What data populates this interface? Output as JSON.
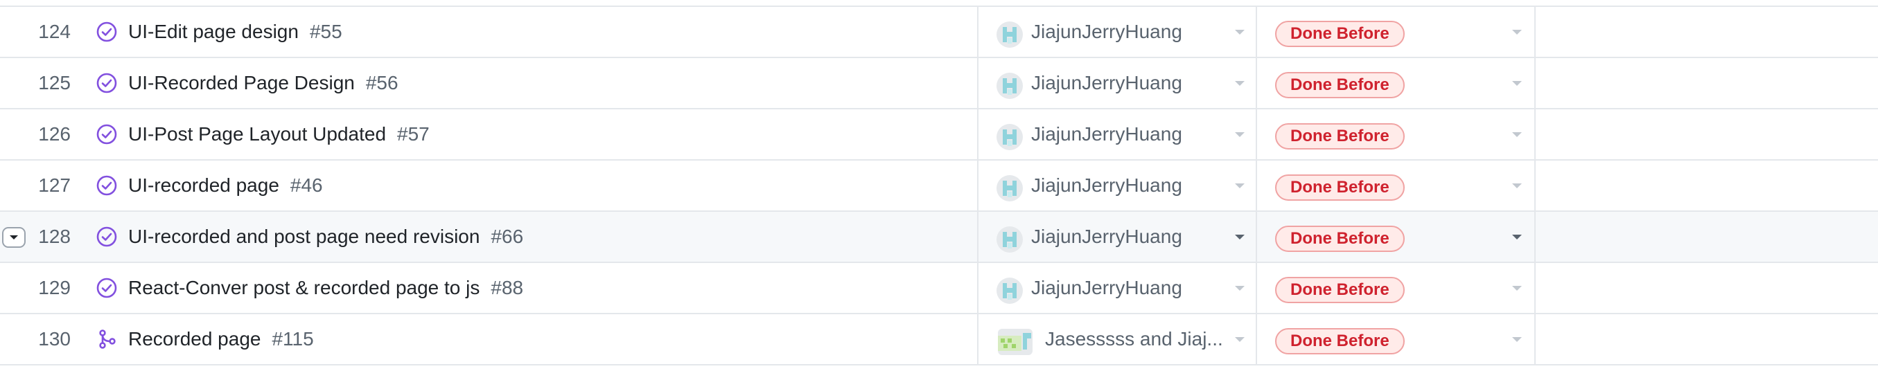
{
  "rows": [
    {
      "num": "124",
      "title": "UI-Edit page design",
      "issue": "#55",
      "type": "issue-closed",
      "assignee": "JiajunJerryHuang",
      "status": "Done Before"
    },
    {
      "num": "125",
      "title": "UI-Recorded Page Design",
      "issue": "#56",
      "type": "issue-closed",
      "assignee": "JiajunJerryHuang",
      "status": "Done Before"
    },
    {
      "num": "126",
      "title": "UI-Post Page Layout Updated",
      "issue": "#57",
      "type": "issue-closed",
      "assignee": "JiajunJerryHuang",
      "status": "Done Before"
    },
    {
      "num": "127",
      "title": "UI-recorded page",
      "issue": "#46",
      "type": "issue-closed",
      "assignee": "JiajunJerryHuang",
      "status": "Done Before"
    },
    {
      "num": "128",
      "title": "UI-recorded and post page need revision",
      "issue": "#66",
      "type": "issue-closed",
      "assignee": "JiajunJerryHuang",
      "status": "Done Before"
    },
    {
      "num": "129",
      "title": "React-Conver post & recorded page to js",
      "issue": "#88",
      "type": "issue-closed",
      "assignee": "JiajunJerryHuang",
      "status": "Done Before"
    },
    {
      "num": "130",
      "title": "Recorded page",
      "issue": "#115",
      "type": "pull-request-merged",
      "assignee": "Jasesssss and Jiaj...",
      "status": "Done Before"
    }
  ],
  "colors": {
    "issue_closed": "#8250df",
    "status_red": "#cf222e",
    "status_bg": "#ffebe9"
  }
}
